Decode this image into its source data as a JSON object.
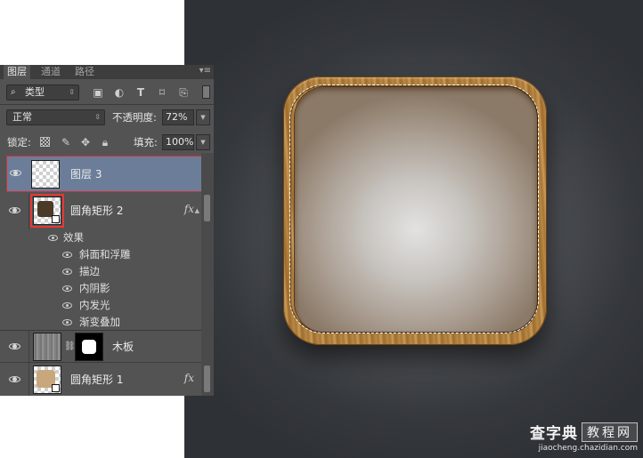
{
  "panel": {
    "tabs": [
      "图层",
      "通道",
      "路径"
    ],
    "menu_glyph": "▾≡",
    "filter": {
      "label": "类型",
      "icons": [
        "image-filter-icon",
        "adjustment-filter-icon",
        "type-filter-icon",
        "shape-filter-icon",
        "smart-object-filter-icon"
      ]
    },
    "blend_mode": "正常",
    "opacity_label": "不透明度:",
    "opacity_value": "72%",
    "lock_label": "锁定:",
    "fill_label": "填充:",
    "fill_value": "100%"
  },
  "layers": [
    {
      "name": "图层 3",
      "selected": true,
      "thumbnail": "transparent"
    },
    {
      "name": "圆角矩形 2",
      "selected": false,
      "thumbnail": "shape-dark",
      "has_fx": true,
      "fx": "fx",
      "effects_label": "效果",
      "effects": [
        "斜面和浮雕",
        "描边",
        "内阴影",
        "内发光",
        "渐变叠加"
      ]
    },
    {
      "name": "木板",
      "selected": false,
      "thumbnail": "wood",
      "has_mask": true
    },
    {
      "name": "圆角矩形 1",
      "selected": false,
      "thumbnail": "shape-tan",
      "has_fx": true,
      "fx": "fx"
    }
  ],
  "watermark": {
    "brand": "查字典",
    "box": "教程网",
    "url": "jiaocheng.chazidian.com"
  },
  "colors": {
    "panel_bg": "#535353",
    "selected_layer": "#6b7d99",
    "highlight_border": "#d32f2f",
    "wood": "#b98a4a"
  }
}
